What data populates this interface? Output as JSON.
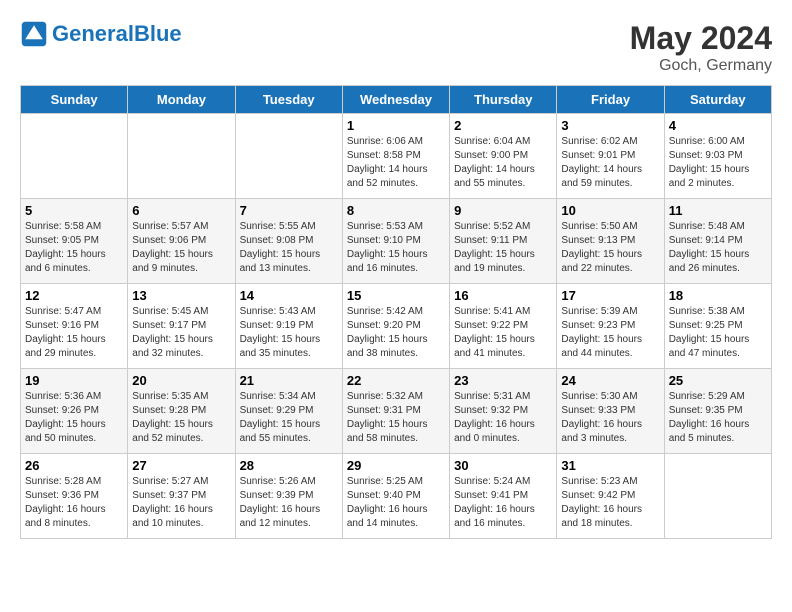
{
  "header": {
    "logo_general": "General",
    "logo_blue": "Blue",
    "month_year": "May 2024",
    "location": "Goch, Germany"
  },
  "days_of_week": [
    "Sunday",
    "Monday",
    "Tuesday",
    "Wednesday",
    "Thursday",
    "Friday",
    "Saturday"
  ],
  "weeks": [
    [
      {
        "day": "",
        "sunrise": "",
        "sunset": "",
        "daylight": ""
      },
      {
        "day": "",
        "sunrise": "",
        "sunset": "",
        "daylight": ""
      },
      {
        "day": "",
        "sunrise": "",
        "sunset": "",
        "daylight": ""
      },
      {
        "day": "1",
        "sunrise": "Sunrise: 6:06 AM",
        "sunset": "Sunset: 8:58 PM",
        "daylight": "Daylight: 14 hours and 52 minutes."
      },
      {
        "day": "2",
        "sunrise": "Sunrise: 6:04 AM",
        "sunset": "Sunset: 9:00 PM",
        "daylight": "Daylight: 14 hours and 55 minutes."
      },
      {
        "day": "3",
        "sunrise": "Sunrise: 6:02 AM",
        "sunset": "Sunset: 9:01 PM",
        "daylight": "Daylight: 14 hours and 59 minutes."
      },
      {
        "day": "4",
        "sunrise": "Sunrise: 6:00 AM",
        "sunset": "Sunset: 9:03 PM",
        "daylight": "Daylight: 15 hours and 2 minutes."
      }
    ],
    [
      {
        "day": "5",
        "sunrise": "Sunrise: 5:58 AM",
        "sunset": "Sunset: 9:05 PM",
        "daylight": "Daylight: 15 hours and 6 minutes."
      },
      {
        "day": "6",
        "sunrise": "Sunrise: 5:57 AM",
        "sunset": "Sunset: 9:06 PM",
        "daylight": "Daylight: 15 hours and 9 minutes."
      },
      {
        "day": "7",
        "sunrise": "Sunrise: 5:55 AM",
        "sunset": "Sunset: 9:08 PM",
        "daylight": "Daylight: 15 hours and 13 minutes."
      },
      {
        "day": "8",
        "sunrise": "Sunrise: 5:53 AM",
        "sunset": "Sunset: 9:10 PM",
        "daylight": "Daylight: 15 hours and 16 minutes."
      },
      {
        "day": "9",
        "sunrise": "Sunrise: 5:52 AM",
        "sunset": "Sunset: 9:11 PM",
        "daylight": "Daylight: 15 hours and 19 minutes."
      },
      {
        "day": "10",
        "sunrise": "Sunrise: 5:50 AM",
        "sunset": "Sunset: 9:13 PM",
        "daylight": "Daylight: 15 hours and 22 minutes."
      },
      {
        "day": "11",
        "sunrise": "Sunrise: 5:48 AM",
        "sunset": "Sunset: 9:14 PM",
        "daylight": "Daylight: 15 hours and 26 minutes."
      }
    ],
    [
      {
        "day": "12",
        "sunrise": "Sunrise: 5:47 AM",
        "sunset": "Sunset: 9:16 PM",
        "daylight": "Daylight: 15 hours and 29 minutes."
      },
      {
        "day": "13",
        "sunrise": "Sunrise: 5:45 AM",
        "sunset": "Sunset: 9:17 PM",
        "daylight": "Daylight: 15 hours and 32 minutes."
      },
      {
        "day": "14",
        "sunrise": "Sunrise: 5:43 AM",
        "sunset": "Sunset: 9:19 PM",
        "daylight": "Daylight: 15 hours and 35 minutes."
      },
      {
        "day": "15",
        "sunrise": "Sunrise: 5:42 AM",
        "sunset": "Sunset: 9:20 PM",
        "daylight": "Daylight: 15 hours and 38 minutes."
      },
      {
        "day": "16",
        "sunrise": "Sunrise: 5:41 AM",
        "sunset": "Sunset: 9:22 PM",
        "daylight": "Daylight: 15 hours and 41 minutes."
      },
      {
        "day": "17",
        "sunrise": "Sunrise: 5:39 AM",
        "sunset": "Sunset: 9:23 PM",
        "daylight": "Daylight: 15 hours and 44 minutes."
      },
      {
        "day": "18",
        "sunrise": "Sunrise: 5:38 AM",
        "sunset": "Sunset: 9:25 PM",
        "daylight": "Daylight: 15 hours and 47 minutes."
      }
    ],
    [
      {
        "day": "19",
        "sunrise": "Sunrise: 5:36 AM",
        "sunset": "Sunset: 9:26 PM",
        "daylight": "Daylight: 15 hours and 50 minutes."
      },
      {
        "day": "20",
        "sunrise": "Sunrise: 5:35 AM",
        "sunset": "Sunset: 9:28 PM",
        "daylight": "Daylight: 15 hours and 52 minutes."
      },
      {
        "day": "21",
        "sunrise": "Sunrise: 5:34 AM",
        "sunset": "Sunset: 9:29 PM",
        "daylight": "Daylight: 15 hours and 55 minutes."
      },
      {
        "day": "22",
        "sunrise": "Sunrise: 5:32 AM",
        "sunset": "Sunset: 9:31 PM",
        "daylight": "Daylight: 15 hours and 58 minutes."
      },
      {
        "day": "23",
        "sunrise": "Sunrise: 5:31 AM",
        "sunset": "Sunset: 9:32 PM",
        "daylight": "Daylight: 16 hours and 0 minutes."
      },
      {
        "day": "24",
        "sunrise": "Sunrise: 5:30 AM",
        "sunset": "Sunset: 9:33 PM",
        "daylight": "Daylight: 16 hours and 3 minutes."
      },
      {
        "day": "25",
        "sunrise": "Sunrise: 5:29 AM",
        "sunset": "Sunset: 9:35 PM",
        "daylight": "Daylight: 16 hours and 5 minutes."
      }
    ],
    [
      {
        "day": "26",
        "sunrise": "Sunrise: 5:28 AM",
        "sunset": "Sunset: 9:36 PM",
        "daylight": "Daylight: 16 hours and 8 minutes."
      },
      {
        "day": "27",
        "sunrise": "Sunrise: 5:27 AM",
        "sunset": "Sunset: 9:37 PM",
        "daylight": "Daylight: 16 hours and 10 minutes."
      },
      {
        "day": "28",
        "sunrise": "Sunrise: 5:26 AM",
        "sunset": "Sunset: 9:39 PM",
        "daylight": "Daylight: 16 hours and 12 minutes."
      },
      {
        "day": "29",
        "sunrise": "Sunrise: 5:25 AM",
        "sunset": "Sunset: 9:40 PM",
        "daylight": "Daylight: 16 hours and 14 minutes."
      },
      {
        "day": "30",
        "sunrise": "Sunrise: 5:24 AM",
        "sunset": "Sunset: 9:41 PM",
        "daylight": "Daylight: 16 hours and 16 minutes."
      },
      {
        "day": "31",
        "sunrise": "Sunrise: 5:23 AM",
        "sunset": "Sunset: 9:42 PM",
        "daylight": "Daylight: 16 hours and 18 minutes."
      },
      {
        "day": "",
        "sunrise": "",
        "sunset": "",
        "daylight": ""
      }
    ]
  ]
}
